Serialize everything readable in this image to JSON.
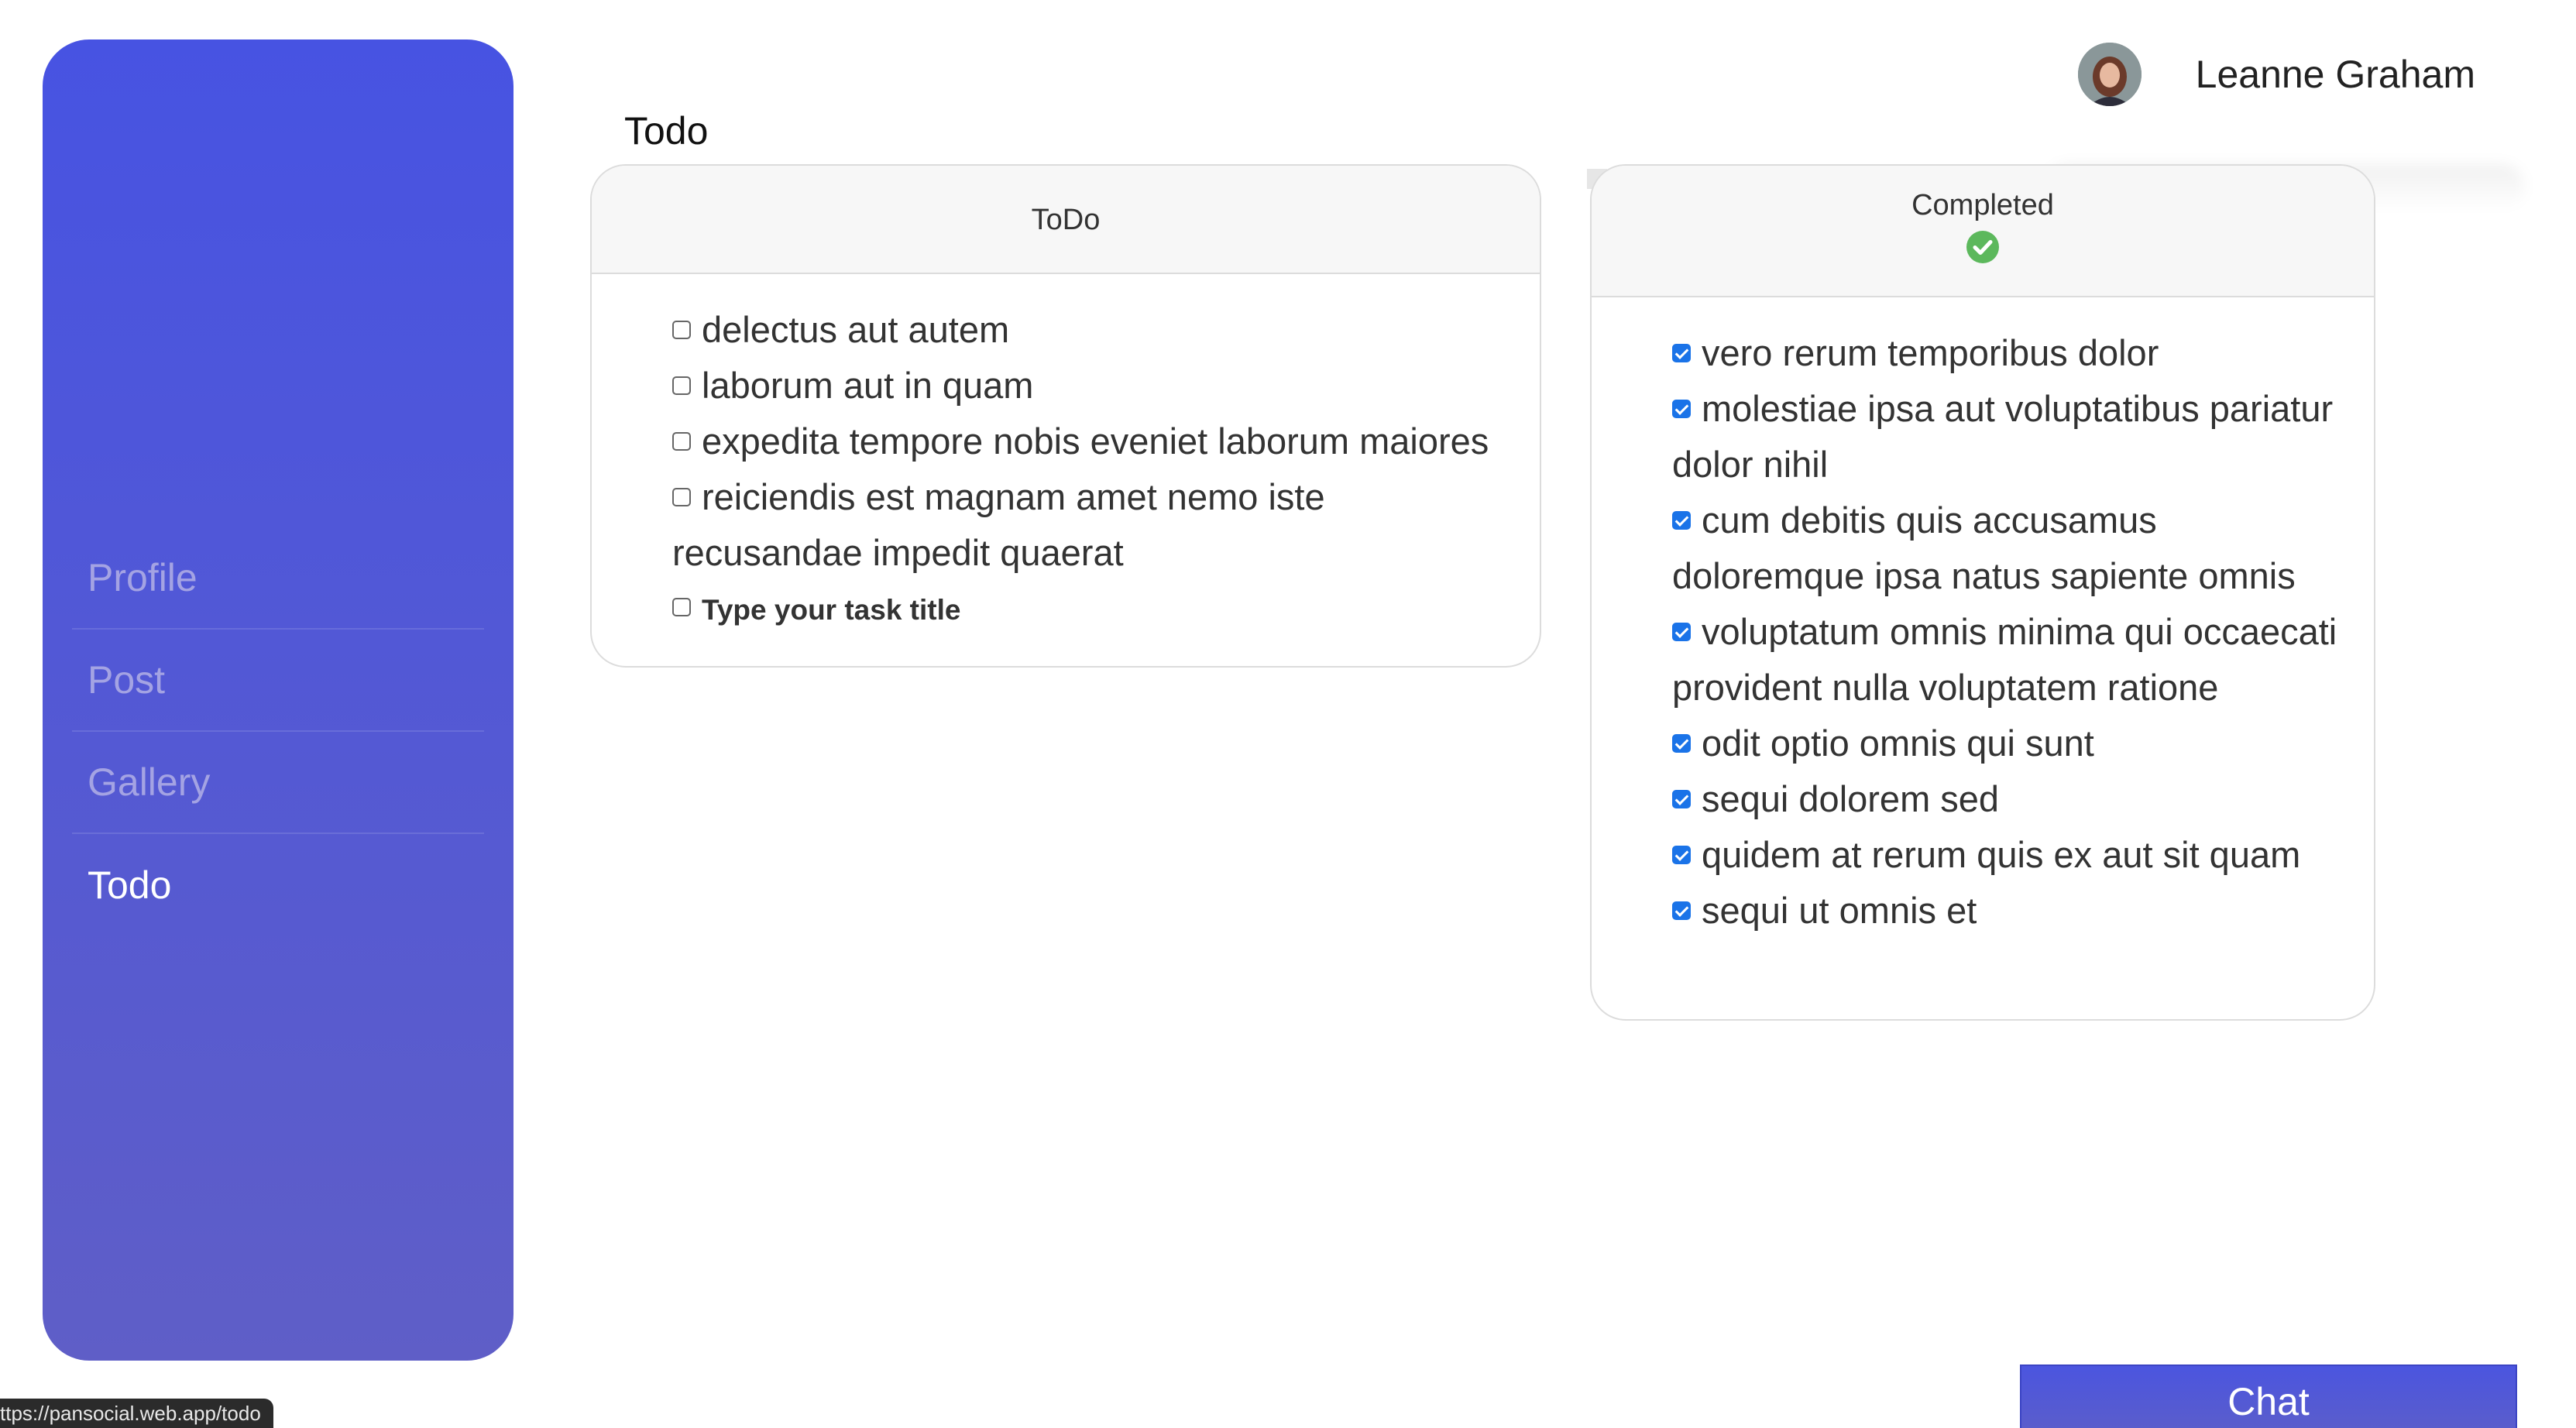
{
  "sidebar": {
    "items": [
      {
        "label": "Profile",
        "active": false
      },
      {
        "label": "Post",
        "active": false
      },
      {
        "label": "Gallery",
        "active": false
      },
      {
        "label": "Todo",
        "active": true
      }
    ]
  },
  "header": {
    "user_name": "Leanne Graham",
    "avatar_icon": "user-avatar"
  },
  "page": {
    "title": "Todo"
  },
  "todo_card": {
    "title": "ToDo",
    "tasks": [
      {
        "label": "delectus aut autem",
        "checked": false
      },
      {
        "label": "laborum aut in quam",
        "checked": false
      },
      {
        "label": "expedita tempore nobis eveniet laborum maiores",
        "checked": false
      },
      {
        "label": "reiciendis est magnam amet nemo iste recusandae impedit quaerat",
        "checked": false
      }
    ],
    "new_task_placeholder": "Type your task title"
  },
  "completed_card": {
    "title": "Completed",
    "icon": "check-circle-icon",
    "icon_color": "#5cb85c",
    "tasks": [
      {
        "label": "vero rerum temporibus dolor",
        "checked": true
      },
      {
        "label": "molestiae ipsa aut voluptatibus pariatur dolor nihil",
        "checked": true
      },
      {
        "label": "cum debitis quis accusamus doloremque ipsa natus sapiente omnis",
        "checked": true
      },
      {
        "label": "voluptatum omnis minima qui occaecati provident nulla voluptatem ratione",
        "checked": true
      },
      {
        "label": "odit optio omnis qui sunt",
        "checked": true
      },
      {
        "label": "sequi dolorem sed",
        "checked": true
      },
      {
        "label": "quidem at rerum quis ex aut sit quam",
        "checked": true
      },
      {
        "label": "sequi ut omnis et",
        "checked": true
      }
    ]
  },
  "chat": {
    "label": "Chat"
  },
  "status_bar": {
    "url": "ttps://pansocial.web.app/todo"
  },
  "colors": {
    "sidebar_top": "#4753e2",
    "sidebar_bottom": "#5f5ec7",
    "checkbox_checked": "#1a73e8",
    "chat_button": "#4b55df"
  }
}
